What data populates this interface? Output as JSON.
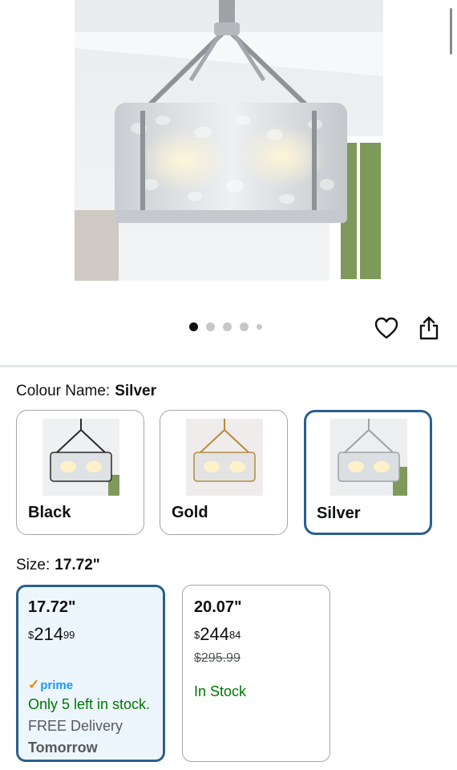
{
  "product_image": {
    "alt_icon": "chandelier-product-image"
  },
  "carousel": {
    "count": 5,
    "active_index": 0
  },
  "actions": {
    "wishlist_icon": "heart-icon",
    "share_icon": "share-icon"
  },
  "colour": {
    "label": "Colour Name:",
    "selected": "Silver",
    "options": [
      {
        "name": "Black",
        "frame_color": "#2b2b2b",
        "selected": false
      },
      {
        "name": "Gold",
        "frame_color": "#b58b3c",
        "selected": false
      },
      {
        "name": "Silver",
        "frame_color": "#b9bcbf",
        "selected": true
      }
    ]
  },
  "size": {
    "label": "Size:",
    "selected": "17.72\"",
    "options": [
      {
        "name": "17.72\"",
        "price_symbol": "$",
        "price_whole": "214",
        "price_fraction": "99",
        "prime_label": "prime",
        "stock": "Only 5 left in stock.",
        "delivery": "FREE Delivery",
        "delivery_day": "Tomorrow",
        "selected": true
      },
      {
        "name": "20.07\"",
        "price_symbol": "$",
        "price_whole": "244",
        "price_fraction": "84",
        "list_price": "$295.99",
        "stock": "In Stock",
        "selected": false
      }
    ]
  },
  "colors": {
    "selected_border": "#2b5f8e",
    "selected_bg": "#edf6fd",
    "stock_green": "#007600",
    "prime_blue": "#1a98ff"
  }
}
